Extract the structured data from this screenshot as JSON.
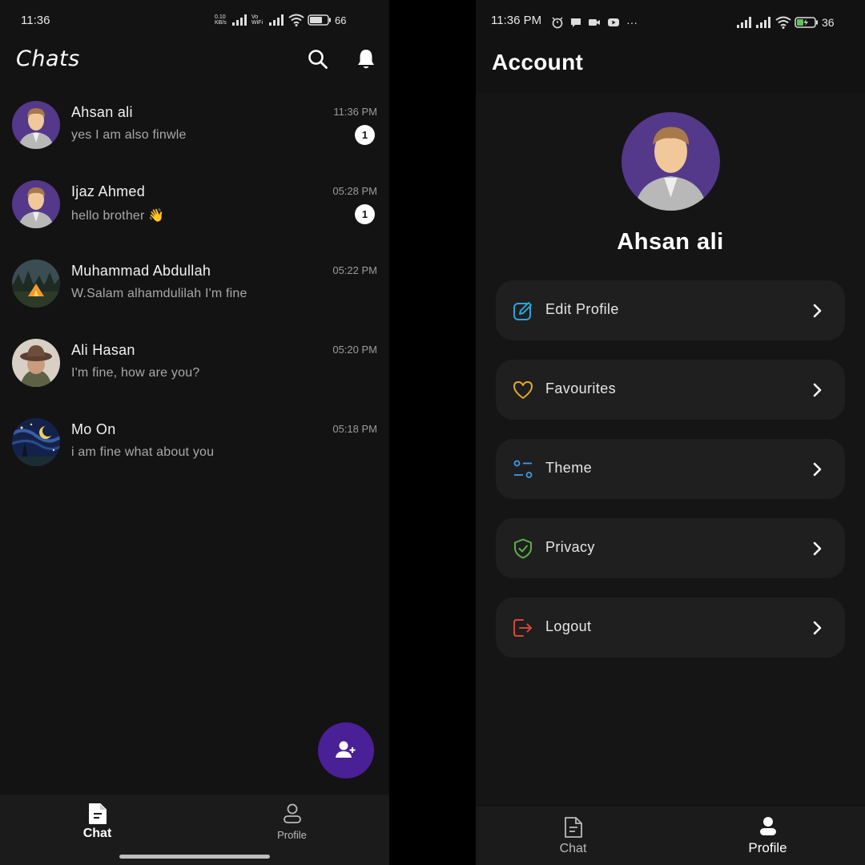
{
  "left": {
    "status": {
      "time": "11:36",
      "net_speed": "0.10 KB/s",
      "vowifi": "Vo WiFi",
      "battery": "66"
    },
    "app_title": "Chats",
    "chats": [
      {
        "name": "Ahsan ali",
        "message": "yes I am also finwle",
        "time": "11:36 PM",
        "unread": "1",
        "avatar": "person-avatar"
      },
      {
        "name": "Ijaz Ahmed",
        "message": "hello brother 👋",
        "time": "05:28 PM",
        "unread": "1",
        "avatar": "person-avatar"
      },
      {
        "name": "Muhammad Abdullah",
        "message": "W.Salam alhamdulilah I'm fine",
        "time": "05:22 PM",
        "unread": "",
        "avatar": "camping-tent-photo"
      },
      {
        "name": "Ali Hasan",
        "message": "I'm fine, how are you?",
        "time": "05:20 PM",
        "unread": "",
        "avatar": "hat-man-photo"
      },
      {
        "name": "Mo On",
        "message": "i am fine what about you",
        "time": "05:18 PM",
        "unread": "",
        "avatar": "starry-night-moon-photo"
      }
    ],
    "nav": {
      "chat": "Chat",
      "profile": "Profile"
    },
    "colors": {
      "fab": "#4a2096",
      "background": "#131313"
    }
  },
  "right": {
    "status": {
      "time": "11:36 PM",
      "more": "···",
      "battery": "36"
    },
    "app_title": "Account",
    "profile_name": "Ahsan ali",
    "menu": [
      {
        "label": "Edit Profile",
        "icon": "edit-icon",
        "color": "#2fa4d8"
      },
      {
        "label": "Favourites",
        "icon": "heart-icon",
        "color": "#e0a92a"
      },
      {
        "label": "Theme",
        "icon": "theme-toggle-icon",
        "color": "#3d9be8"
      },
      {
        "label": "Privacy",
        "icon": "shield-icon",
        "color": "#5ab04a"
      },
      {
        "label": "Logout",
        "icon": "logout-icon",
        "color": "#d8453a"
      }
    ],
    "nav": {
      "chat": "Chat",
      "profile": "Profile"
    }
  }
}
